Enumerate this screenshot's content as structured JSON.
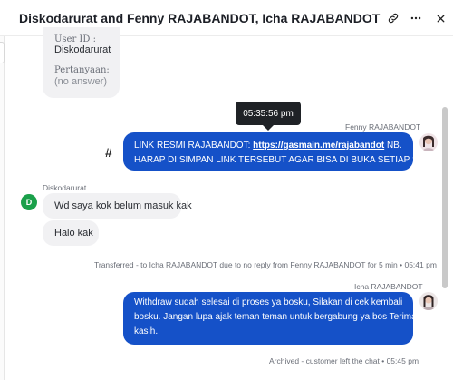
{
  "header": {
    "title": "Diskodarurat and Fenny RAJABANDOT, Icha RAJABANDOT",
    "link_icon": "link-icon",
    "more_icon": "more-horizontal-icon",
    "close_icon": "close-icon"
  },
  "form_card": {
    "user_id_label": "User ID :",
    "user_id_value": "Diskodarurat",
    "question_label": "Pertanyaan:",
    "question_value": "(no answer)"
  },
  "tooltip": {
    "time": "05:35:56 pm"
  },
  "messages": [
    {
      "sender": "Fenny RAJABANDOT",
      "prefix": "LINK RESMI RAJABANDOT: ",
      "link": "https://gasmain.me/rajabandot",
      "suffix": " NB.",
      "line2": "HARAP DI SIMPAN LINK TERSEBUT AGAR BISA DI BUKA SETIAP SAAT."
    },
    {
      "sender": "Diskodarurat",
      "avatar_letter": "D",
      "text1": "Wd saya kok belum masuk kak",
      "text2": "Halo kak"
    },
    {
      "sender": "Icha RAJABANDOT",
      "line1": "Withdraw sudah selesai di proses ya bosku, Silakan di cek kembali",
      "line2": "bosku. Jangan lupa ajak teman teman untuk bergabung ya bos Terima",
      "line3": "kasih."
    }
  ],
  "system": {
    "transferred": "Transferred - to Icha RAJABANDOT due to no reply from Fenny RAJABANDOT for 5 min • 05:41 pm",
    "archived": "Archived - customer left the chat • 05:45 pm"
  },
  "left_marker": "#",
  "colors": {
    "outgoing": "#1551c8",
    "incoming": "#f1f1f3",
    "avatar_d": "#1aa04a"
  }
}
